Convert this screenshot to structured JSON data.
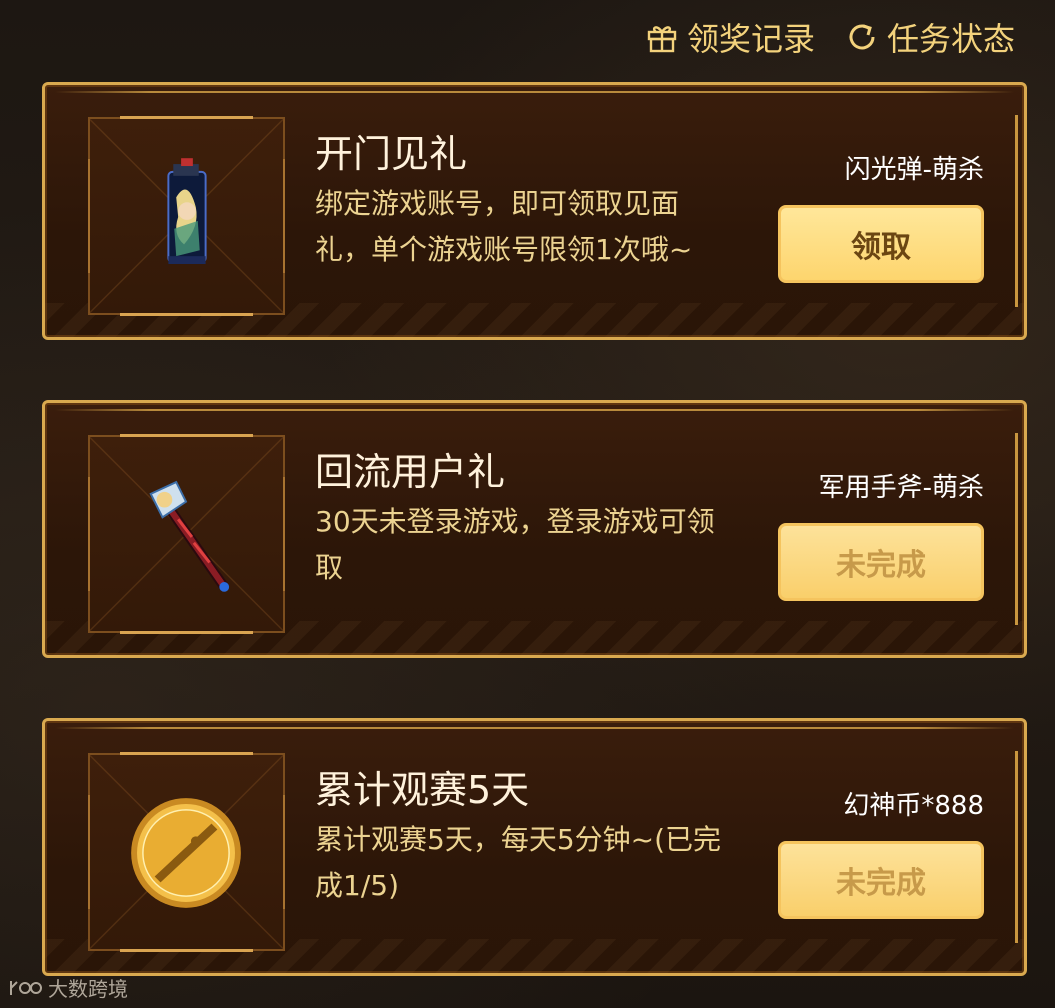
{
  "header": {
    "records_label": "领奖记录",
    "status_label": "任务状态"
  },
  "tasks": [
    {
      "title": "开门见礼",
      "description": "绑定游戏账号，即可领取见面礼，单个游戏账号限领1次哦~",
      "reward": "闪光弹-萌杀",
      "button": "领取",
      "state": "claimable",
      "icon": "flashbang-icon"
    },
    {
      "title": "回流用户礼",
      "description": "30天未登录游戏，登录游戏可领取",
      "reward": "军用手斧-萌杀",
      "button": "未完成",
      "state": "incomplete",
      "icon": "axe-icon"
    },
    {
      "title": "累计观赛5天",
      "description": "累计观赛5天，每天5分钟~(已完成1/5)",
      "reward": "幻神币*888",
      "button": "未完成",
      "state": "incomplete",
      "icon": "coin-icon"
    }
  ],
  "watermark": "大数跨境",
  "colors": {
    "accent_gold": "#d9a94f",
    "button_yellow": "#fdd56e",
    "title_text": "#fff2dc",
    "desc_text": "#ecd391"
  }
}
